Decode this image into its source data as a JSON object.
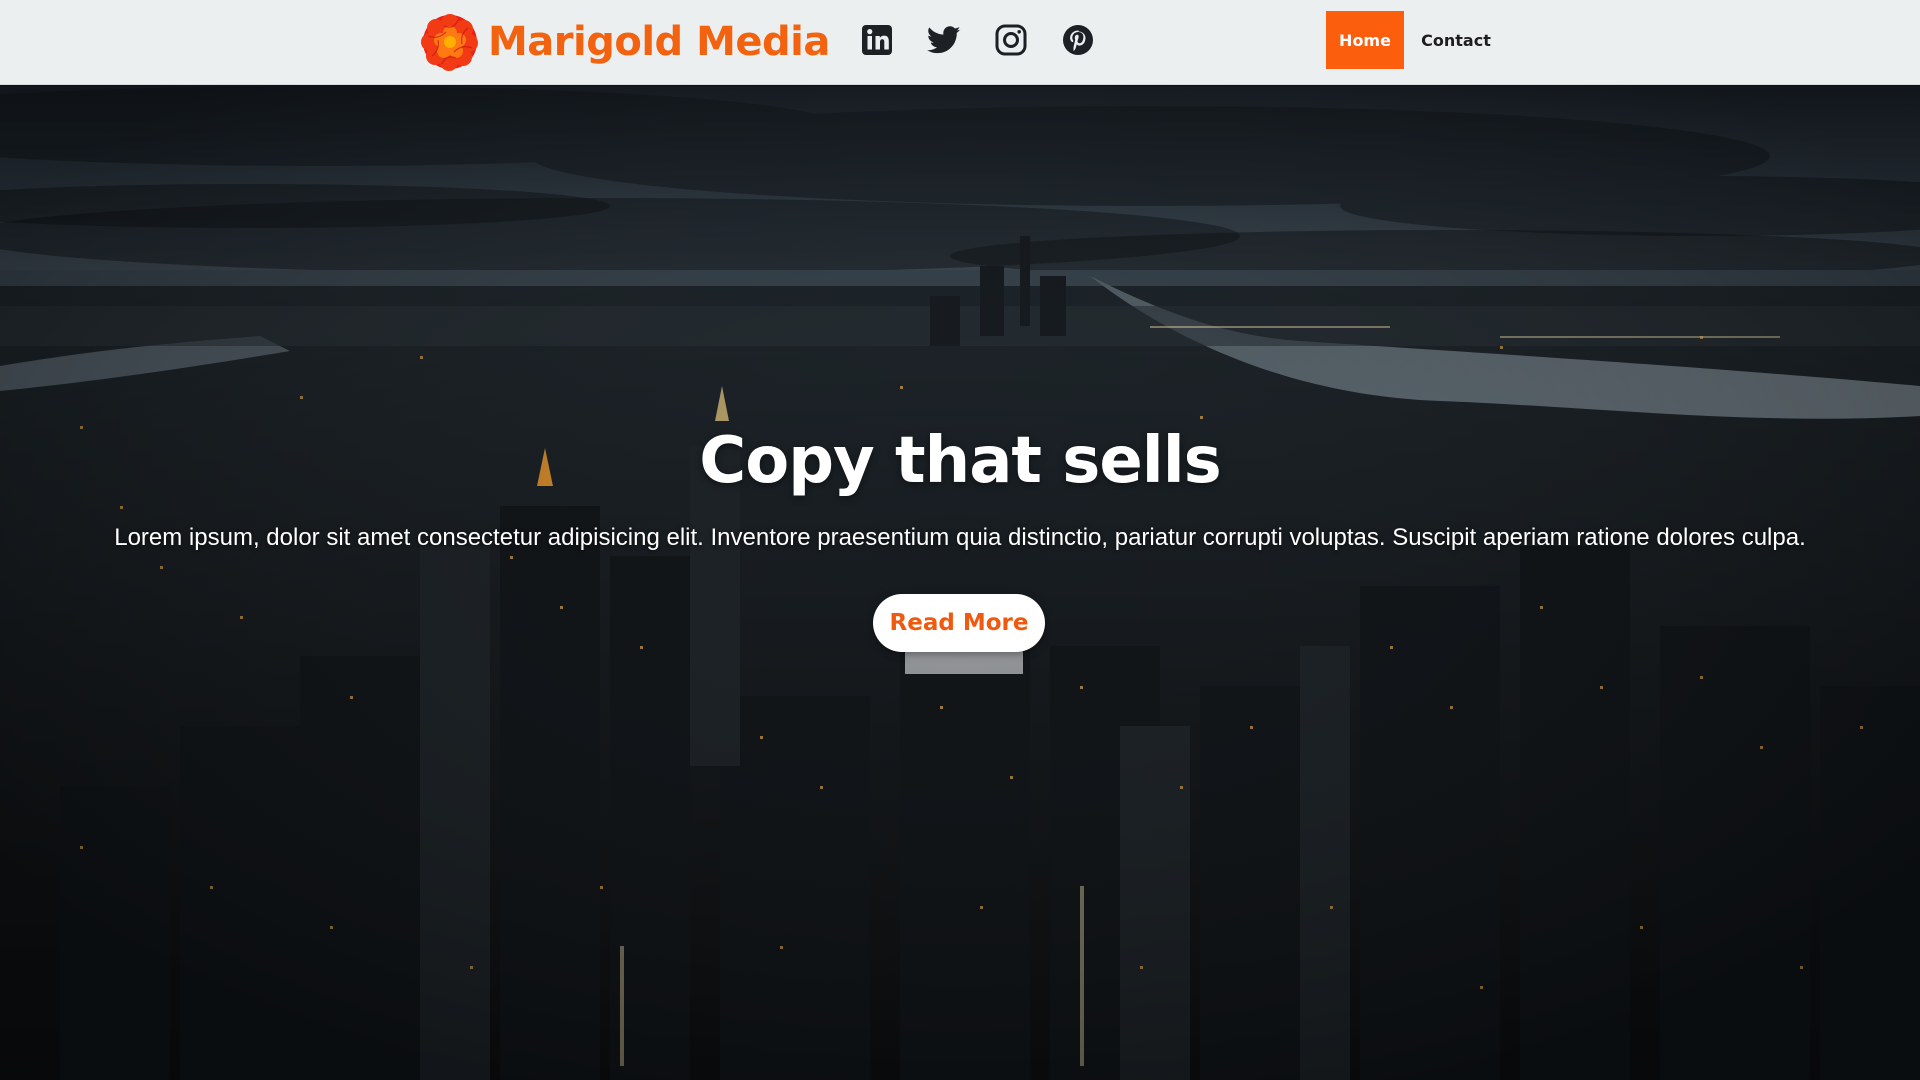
{
  "brand": {
    "name": "Marigold Media",
    "logo_icon": "marigold-flower-icon",
    "color": "#f2620f"
  },
  "social": [
    {
      "name": "LinkedIn",
      "icon": "linkedin-icon"
    },
    {
      "name": "Twitter",
      "icon": "twitter-icon"
    },
    {
      "name": "Instagram",
      "icon": "instagram-icon"
    },
    {
      "name": "Pinterest",
      "icon": "pinterest-icon"
    }
  ],
  "nav": {
    "items": [
      {
        "label": "Home",
        "active": true
      },
      {
        "label": "Contact",
        "active": false
      }
    ],
    "active_color": "#fb5e0c",
    "background": "#eceff0"
  },
  "hero": {
    "title": "Copy that sells",
    "text": "Lorem ipsum, dolor sit amet consectetur adipisicing elit. Inventore praesentium quia distinctio, pariatur corrupti voluptas. Suscipit aperiam ratione dolores culpa.",
    "button_label": "Read More",
    "button_text_color": "#ef5a10",
    "background_image": "night aerial city skyline photo"
  }
}
